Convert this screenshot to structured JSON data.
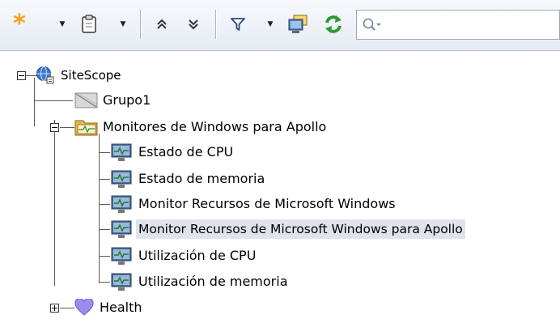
{
  "toolbar": {
    "buttons": [
      {
        "name": "new-item",
        "icon": "asterisk-icon",
        "has_dropdown": true
      },
      {
        "name": "clipboard",
        "icon": "clipboard-icon",
        "has_dropdown": true
      },
      {
        "name": "collapse-all",
        "icon": "double-chevron-up-icon"
      },
      {
        "name": "expand-all",
        "icon": "double-chevron-down-icon"
      },
      {
        "name": "filter",
        "icon": "filter-icon",
        "has_dropdown": true
      },
      {
        "name": "monitor-view",
        "icon": "monitor-view-icon"
      },
      {
        "name": "refresh",
        "icon": "refresh-icon"
      }
    ],
    "search": {
      "placeholder": "",
      "value": ""
    }
  },
  "tree": {
    "root": {
      "label": "SiteScope",
      "icon": "globe-icon"
    },
    "group1": {
      "label": "Grupo1",
      "icon": "disabled-group-icon"
    },
    "group2": {
      "label": "Monitores de Windows para Apollo",
      "icon": "monitor-group-icon",
      "children": [
        {
          "label": "Estado de CPU",
          "icon": "monitor-icon"
        },
        {
          "label": "Estado de memoria",
          "icon": "monitor-icon"
        },
        {
          "label": "Monitor Recursos de Microsoft Windows",
          "icon": "monitor-icon"
        },
        {
          "label": "Monitor Recursos de Microsoft Windows para Apollo",
          "icon": "monitor-icon",
          "selected": true
        },
        {
          "label": "Utilización de CPU",
          "icon": "monitor-icon"
        },
        {
          "label": "Utilización de memoria",
          "icon": "monitor-icon"
        }
      ]
    },
    "health": {
      "label": "Health",
      "icon": "heart-icon"
    }
  },
  "colors": {
    "selection": "#dfe4ec",
    "toolbar_bg": "#eaf0f6",
    "asterisk": "#f3a21a",
    "refresh": "#2e9a2e",
    "heart": "#9b8df0",
    "folder": "#e6b84a"
  }
}
